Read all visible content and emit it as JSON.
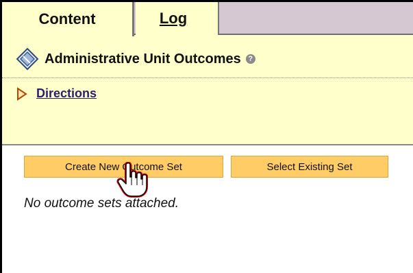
{
  "tabs": [
    {
      "label": "Content",
      "active": true
    },
    {
      "label": "Log",
      "active": false
    }
  ],
  "header": {
    "title": "Administrative Unit Outcomes",
    "title_icon": "diamond-icon",
    "help_icon": "help-icon",
    "help_glyph": "?"
  },
  "directions": {
    "label": "Directions",
    "icon": "expand-triangle-icon"
  },
  "buttons": {
    "create_label": "Create New Outcome Set",
    "select_label": "Select Existing Set"
  },
  "main": {
    "empty_message": "No outcome sets attached."
  },
  "colors": {
    "panel_bg": "#ffffcc",
    "tabbar_bg": "#d6c8d3",
    "button_bg": "#ffcc66",
    "link": "#2a1f6b",
    "cursor_outline": "#cc0000"
  }
}
